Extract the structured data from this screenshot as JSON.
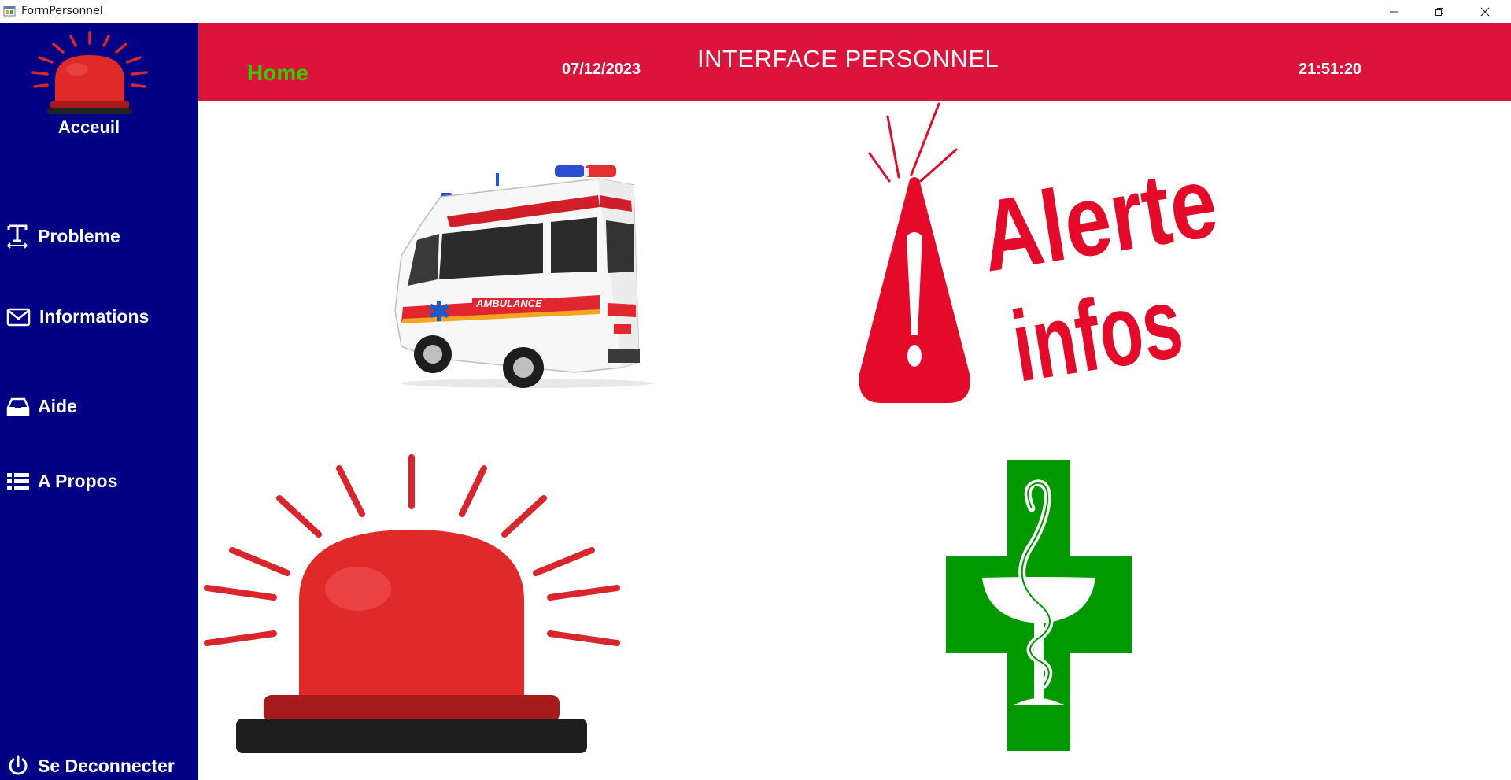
{
  "window": {
    "title": "FormPersonnel"
  },
  "sidebar": {
    "home_label": "Acceuil",
    "items": [
      {
        "label": "Probleme",
        "icon": "text-cursor-icon"
      },
      {
        "label": "Informations",
        "icon": "mail-icon"
      },
      {
        "label": "Aide",
        "icon": "inbox-icon"
      },
      {
        "label": "A Propos",
        "icon": "list-icon"
      }
    ],
    "logout_label": "Se Deconnecter"
  },
  "header": {
    "home_label": "Home",
    "date": "07/12/2023",
    "title": "INTERFACE PERSONNEL",
    "time": "21:51:20"
  },
  "tiles": {
    "alert_line1": "Alerte",
    "alert_line2": "infos"
  },
  "colors": {
    "sidebar": "#010183",
    "header": "#dc143c",
    "home_link": "#33cc00",
    "alert_red": "#e30a2a",
    "pharmacy_green": "#009900"
  }
}
